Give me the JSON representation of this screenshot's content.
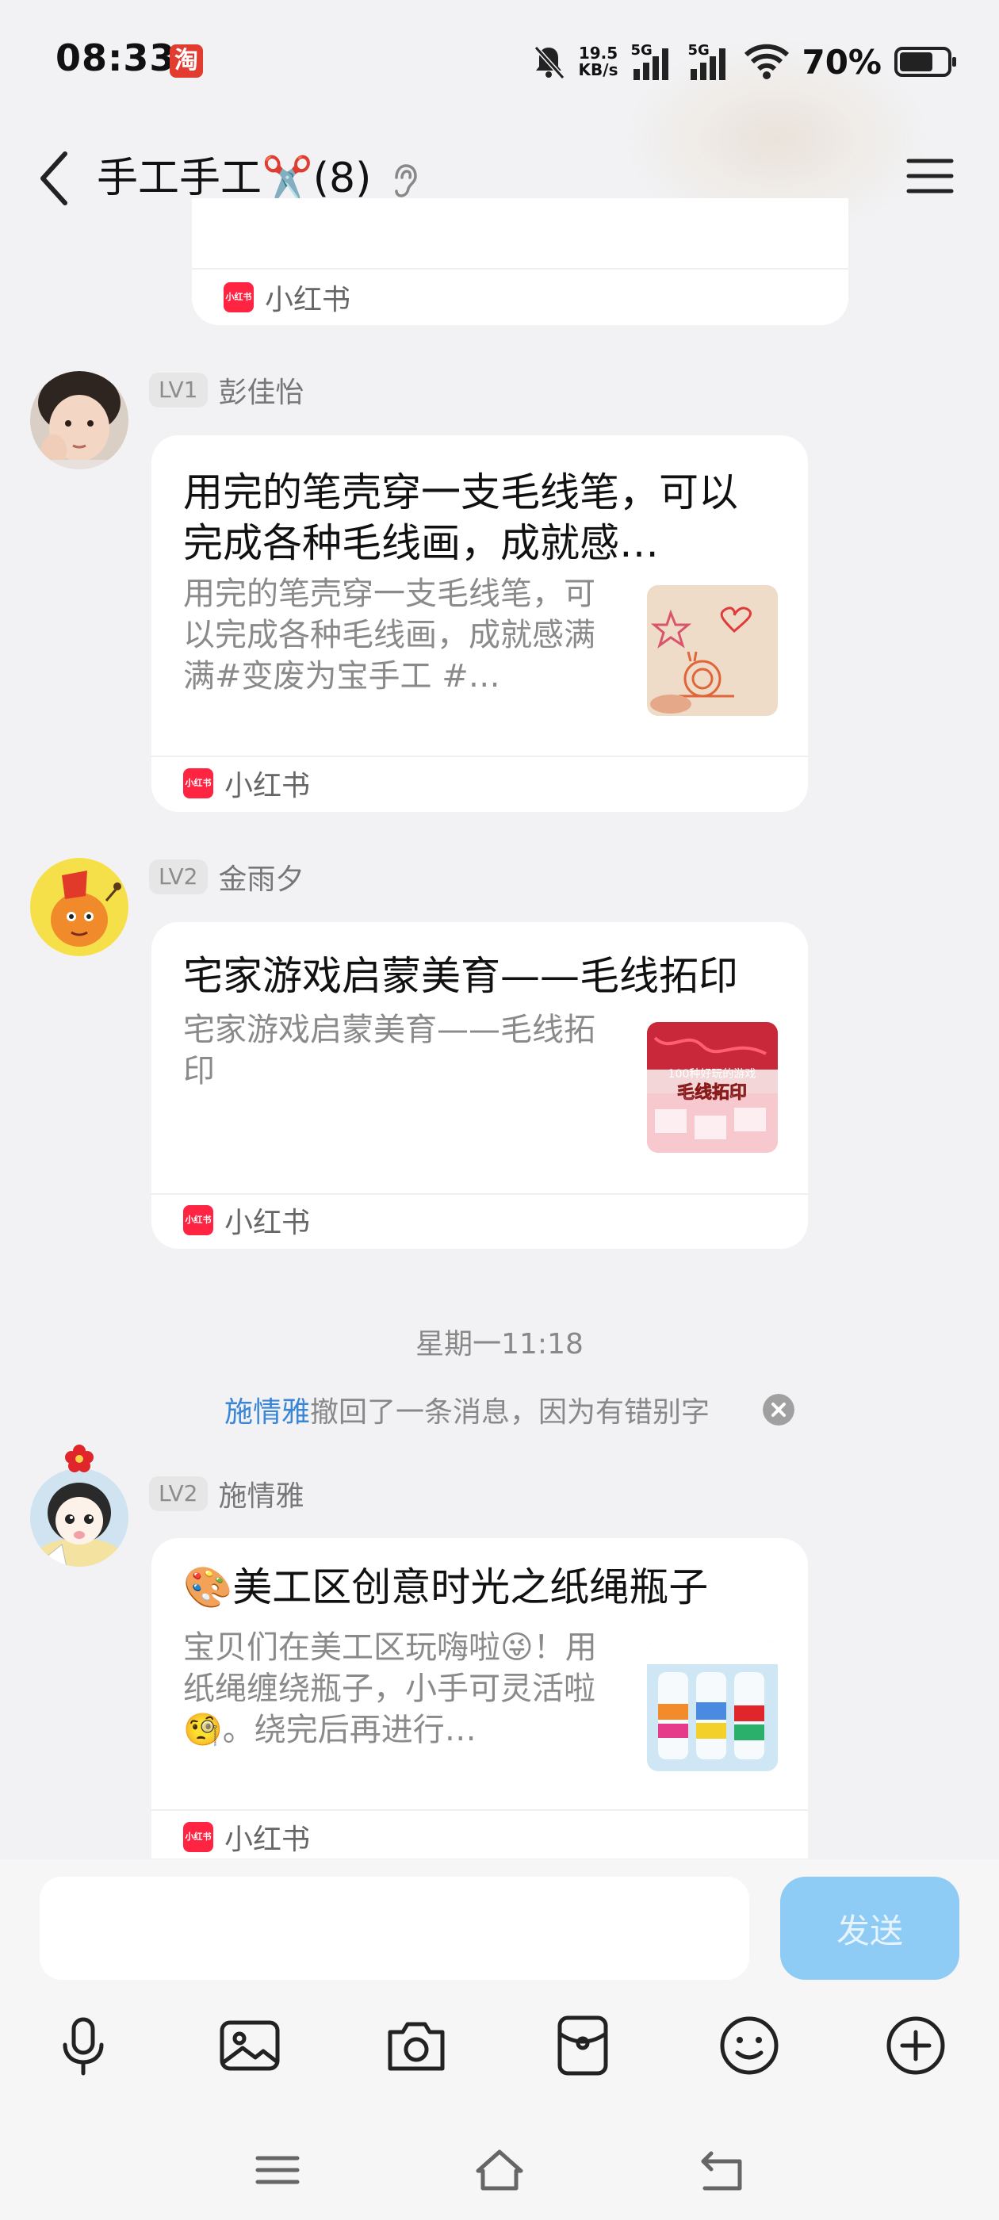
{
  "status_bar": {
    "time": "08:33",
    "app_badge": "淘",
    "net_speed_value": "19.5",
    "net_speed_unit": "KB/s",
    "signal1_label": "5G",
    "signal2_label": "5G",
    "battery_percent": "70%",
    "battery_level": 0.7
  },
  "header": {
    "title": "手工手工✂️(8)"
  },
  "top_card": {
    "source": "小红书"
  },
  "messages": [
    {
      "level": "LV1",
      "sender": "彭佳怡",
      "card": {
        "title_line1": "用完的笔壳穿一支毛线笔，可以",
        "title_line2": "完成各种毛线画，成就感…",
        "desc": "用完的笔壳穿一支毛线笔，可以完成各种毛线画，成就感满满#变废为宝手工  #…",
        "source": "小红书"
      }
    },
    {
      "level": "LV2",
      "sender": "金雨夕",
      "card": {
        "title_line1": "宅家游戏启蒙美育——毛线拓印",
        "desc": "宅家游戏启蒙美育——毛线拓印",
        "thumb_caption_top": "100种好玩的游戏",
        "thumb_caption_main": "毛线拓印",
        "source": "小红书"
      }
    },
    {
      "level": "LV2",
      "sender": "施情雅",
      "card": {
        "title_line1": "🎨美工区创意时光之纸绳瓶子",
        "desc": "宝贝们在美工区玩嗨啦😜！用纸绳缠绕瓶子，小手可灵活啦🧐。绕完后再进行…",
        "source": "小红书"
      }
    }
  ],
  "timestamp": "星期一11:18",
  "recall_notice": {
    "name": "施情雅",
    "text": "撤回了一条消息，因为有错别字"
  },
  "input": {
    "value": "",
    "send_label": "发送"
  },
  "colors": {
    "background": "#f2f2f4",
    "accent_blue": "#3a86d6",
    "send_button": "#8ecbf5",
    "xiaohongshu_red": "#ff2442"
  }
}
